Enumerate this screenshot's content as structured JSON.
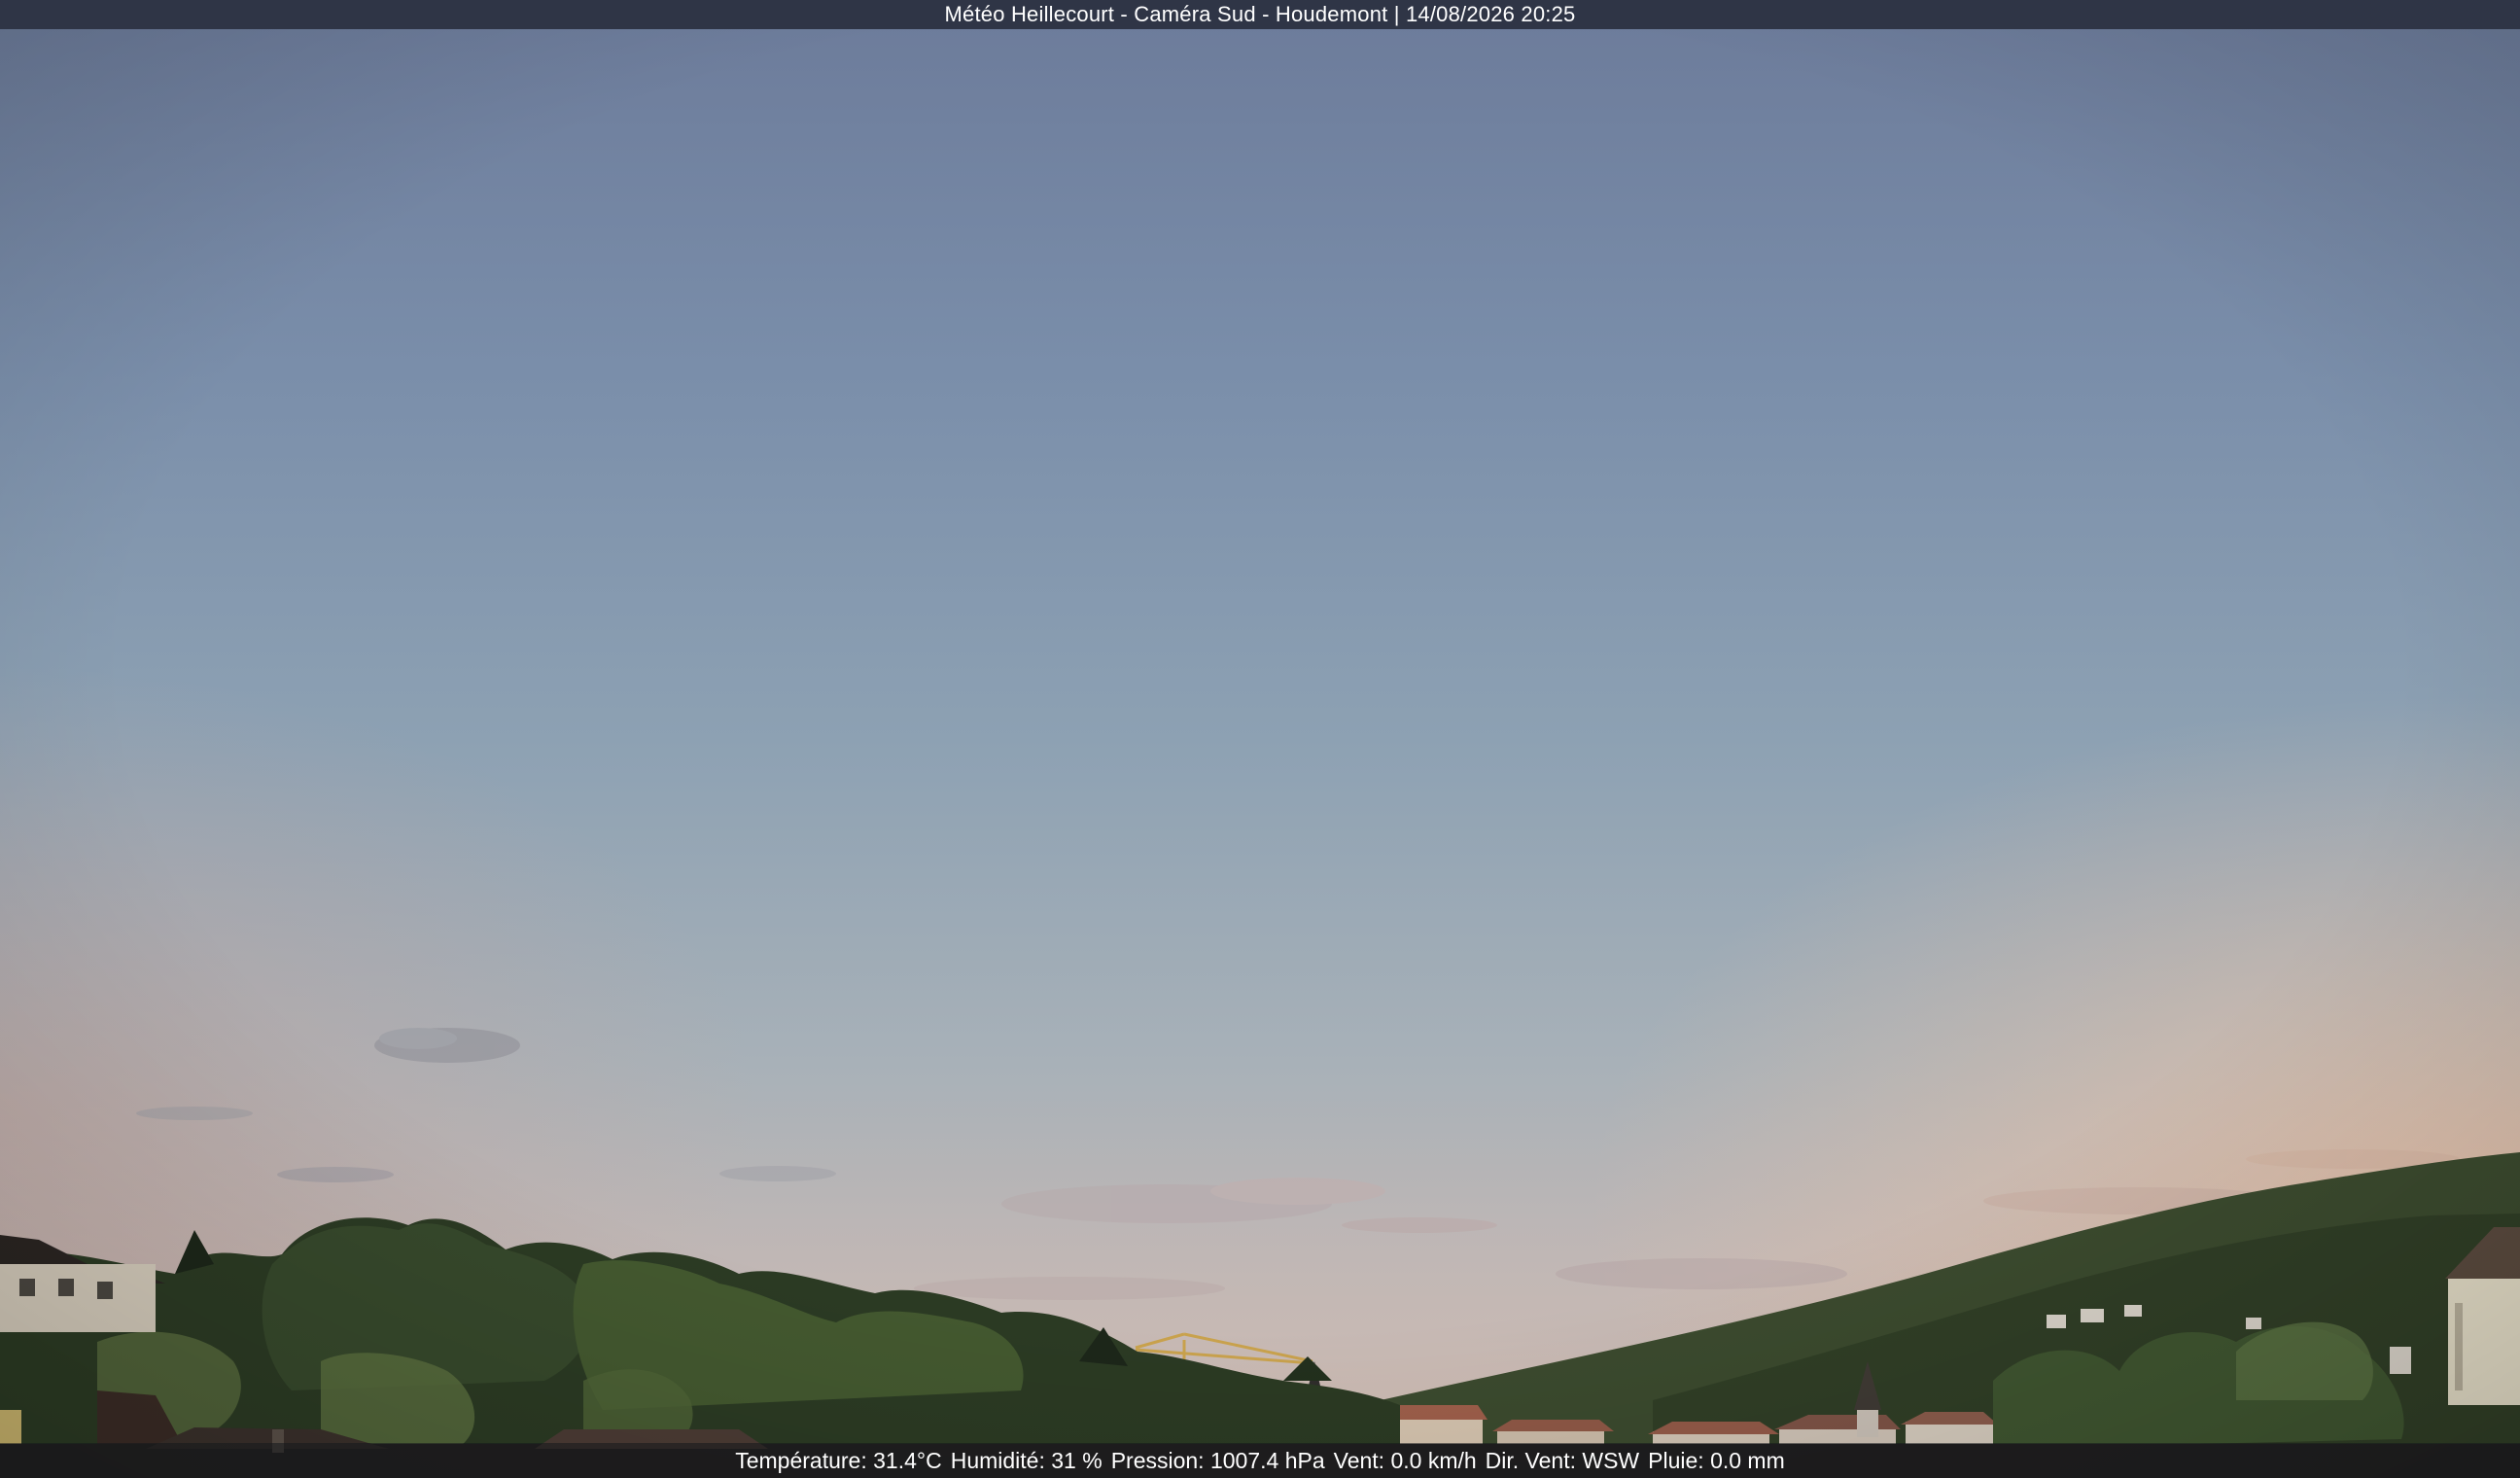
{
  "camera": {
    "caption": "Météo Heillecourt - Caméra Sud - Houdemont | 14/08/2026 20:25"
  },
  "weather": {
    "temperature": "Température: 31.4°C",
    "humidity": "Humidité: 31 %",
    "pressure": "Pression: 1007.4 hPa",
    "wind_speed": "Vent: 0.0 km/h",
    "wind_direction": "Dir. Vent: WSW",
    "rain": "Pluie: 0.0 mm"
  },
  "colors": {
    "sky_top": "#6d7d9c",
    "sky_mid": "#8a9fb4",
    "sky_horizon": "#c4b5b1",
    "sunset_glow": "#e1b9a2",
    "foliage_dark": "#1f2a1d",
    "foliage_mid": "#3a4a2c",
    "banner": "#2f3546"
  }
}
